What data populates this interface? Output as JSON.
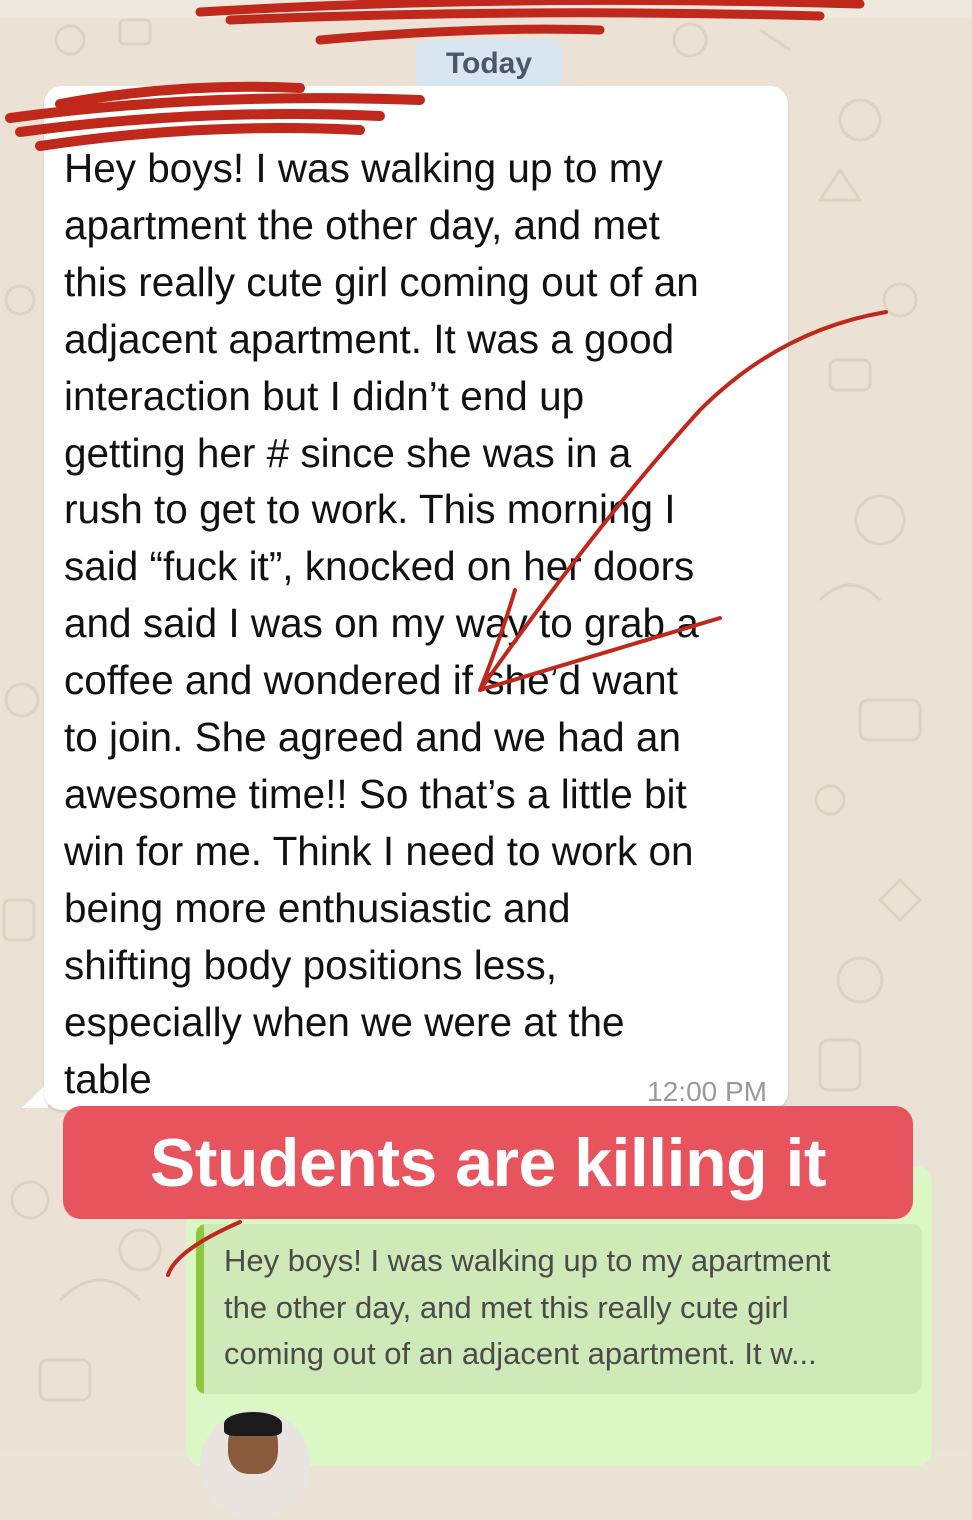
{
  "chat": {
    "date_separator": "Today",
    "message": {
      "text": "Hey boys! I was walking up to my\napartment the other day, and met\nthis really cute girl coming out of an\nadjacent apartment. It was a good\ninteraction but I didn’t end up\ngetting her # since she was in a\nrush to get to work. This morning I\nsaid “fuck it”, knocked on her doors\nand said I was on my way to grab a\ncoffee and wondered if she’d want\nto join. She agreed and we had an\nawesome time!! So that’s a little bit\nwin for me. Think I need to work on\nbeing more enthusiastic and\nshifting body positions less,\nespecially when we were at the\ntable",
      "time": "12:00 PM"
    },
    "reply": {
      "quoted_text": "Hey boys! I was walking up to my apartment\nthe other day, and met this really cute girl\ncoming out of an adjacent apartment. It w..."
    }
  },
  "overlay": {
    "banner_text": "Students are killing it",
    "banner_color": "#e8545e",
    "scribble_color": "#c0281b"
  },
  "colors": {
    "incoming_bubble": "#ffffff",
    "outgoing_bubble": "#dcf7c6",
    "wallpaper": "#ebe2d5",
    "quote_accent": "#8dc63f"
  }
}
